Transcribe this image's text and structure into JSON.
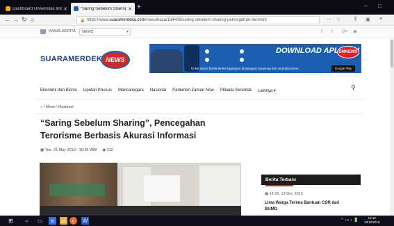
{
  "browser": {
    "tabs": [
      {
        "title": "Dashboard Universitas Indonesi",
        "favicon_color": "#e6b012"
      },
      {
        "title": "\"Saring Sebelum Sharing\", Penc",
        "favicon_color": "#1a5fb0"
      }
    ],
    "new_tab": "+",
    "url_prefix": "https://www.",
    "url_host": "suaramerdeka.com",
    "url_path": "/news/baca/184409/saring-sebelum-sharing-pencegahan-terorism"
  },
  "kanal": {
    "label": "KANAL BERITA",
    "selected": "NEWS",
    "social_icons": [
      "f",
      "t",
      "G+",
      "rss"
    ]
  },
  "header": {
    "logo_text": "SUARAMERDEKA",
    "logo_badge": "NEWS",
    "banner": {
      "headline": "DOWNLOAD APLIKASI",
      "brand": "SMNEWS",
      "tagline": "Untuk akses berita terkini kapanpun dimanapun langsung dari smartphonemu",
      "store": "Google Play"
    }
  },
  "menu": {
    "items": [
      "Ekonomi dan Bisnis",
      "Liputan Khusus",
      "Mancanegara",
      "Nasional",
      "Parlemen Zaman Now",
      "Pilkada Serentak",
      "Lainnya"
    ]
  },
  "breadcrumb": {
    "text": "\\ News \\ Nasional"
  },
  "article": {
    "title": "“Saring Sebelum Sharing”, Pencegahan Terorisme Berbasis Akurasi Informasi",
    "date": "Tue, 21 May 2019 - 10:36 WIB",
    "views": "312"
  },
  "sidebar": {
    "heading": "Berita Terbaru",
    "items": [
      {
        "date": "14:55, 13 Dec 2019",
        "title": "Lima Warga Terima Bantuan CSR dari BUMD"
      }
    ]
  },
  "taskbar": {
    "clock_time": "15:12",
    "clock_date": "13/12/2019"
  },
  "colors": {
    "brand_blue": "#1a3f86",
    "brand_red": "#d8262b",
    "banner_blue": "#1b5fb3",
    "taskbar": "#0f0f1c"
  }
}
